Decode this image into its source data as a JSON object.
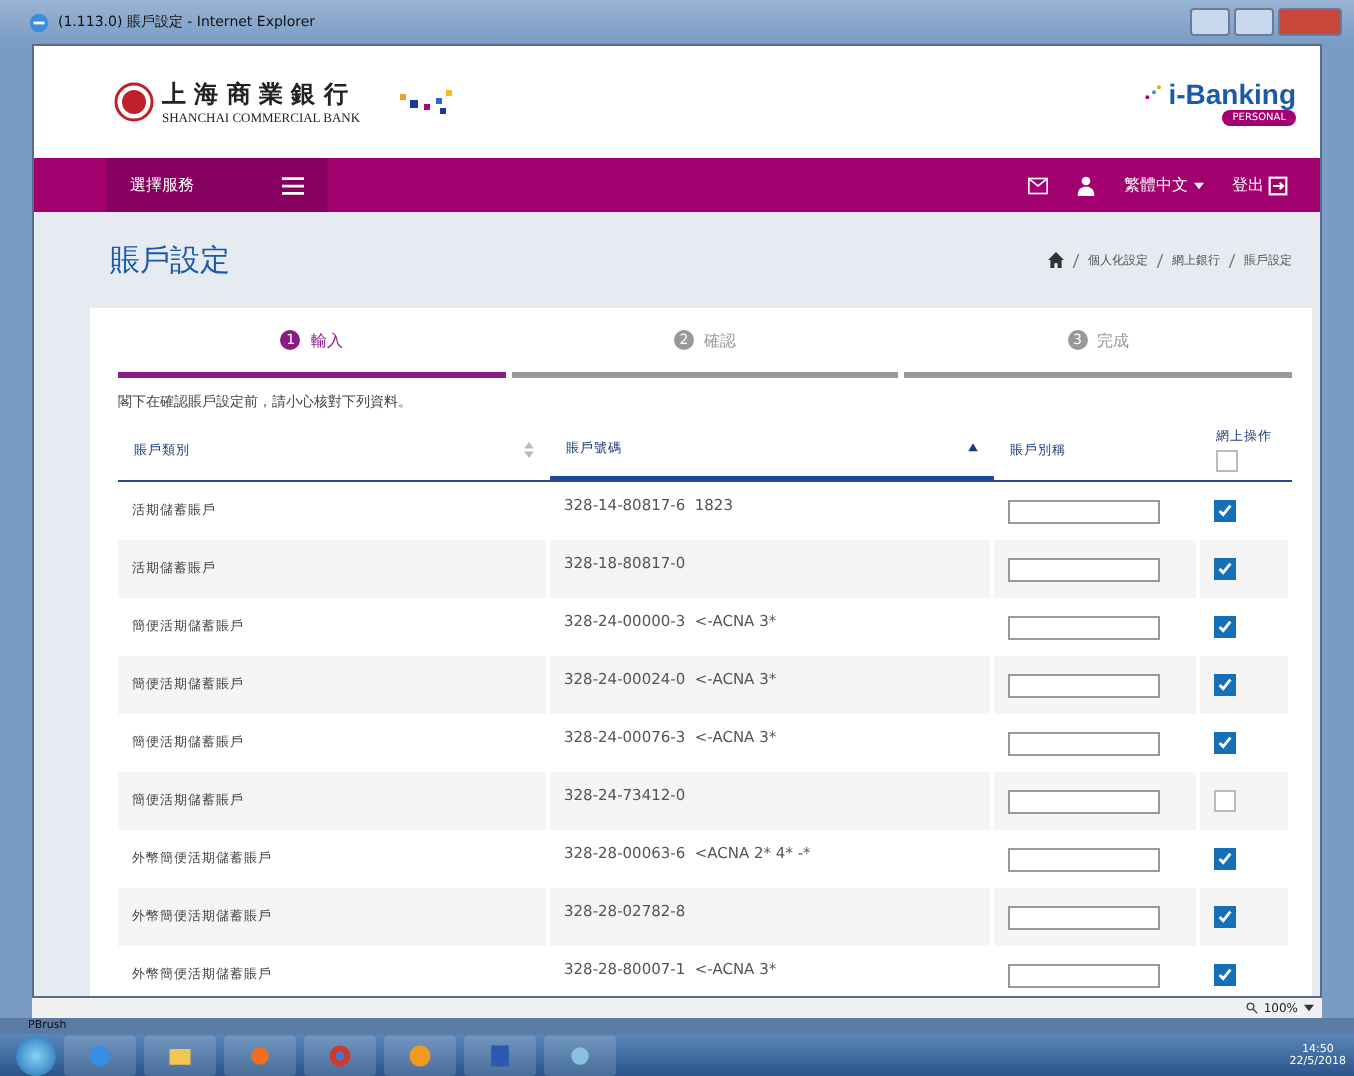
{
  "window": {
    "title": "(1.113.0) 賬戶設定 - Internet Explorer"
  },
  "header": {
    "bank_name": "上 海 商 業 銀 行",
    "bank_name_en": "SHANCHAI COMMERCIAL BANK",
    "brand": "i-Banking",
    "brand_badge": "PERSONAL"
  },
  "nav": {
    "menu_label": "選擇服務",
    "language": "繁體中文",
    "logout": "登出"
  },
  "page": {
    "title": "賬戶設定",
    "breadcrumb": [
      "個人化設定",
      "網上銀行",
      "賬戶設定"
    ]
  },
  "steps": [
    {
      "number": "1",
      "label": "輸入",
      "selected": true
    },
    {
      "number": "2",
      "label": "確認",
      "selected": false
    },
    {
      "number": "3",
      "label": "完成",
      "selected": false
    }
  ],
  "note": "閣下在確認賬戶設定前，請小心核對下列資料。",
  "table": {
    "columns": [
      "賬戶類別",
      "賬戶號碼",
      "賬戶別稱",
      "網上操作"
    ],
    "select_all_checked": false,
    "rows": [
      {
        "type": "活期儲蓄賬戶",
        "number": "328-14-80817-6",
        "remark": "1823",
        "checked": true
      },
      {
        "type": "活期儲蓄賬戶",
        "number": "328-18-80817-0",
        "checked": true
      },
      {
        "type": "簡便活期儲蓄賬戶",
        "number": "328-24-00000-3",
        "remark": "<-ACNA 3*",
        "checked": true
      },
      {
        "type": "簡便活期儲蓄賬戶",
        "number": "328-24-00024-0",
        "remark": "<-ACNA 3*",
        "checked": true
      },
      {
        "type": "簡便活期儲蓄賬戶",
        "number": "328-24-00076-3",
        "remark": "<-ACNA 3*",
        "checked": true
      },
      {
        "type": "簡便活期儲蓄賬戶",
        "number": "328-24-73412-0",
        "checked": false
      },
      {
        "type": "外幣簡便活期儲蓄賬戶",
        "number": "328-28-00063-6",
        "remark": "<ACNA 2* 4* -*",
        "checked": true
      },
      {
        "type": "外幣簡便活期儲蓄賬戶",
        "number": "328-28-02782-8",
        "checked": true
      },
      {
        "type": "外幣簡便活期儲蓄賬戶",
        "number": "328-28-80007-1",
        "remark": "<-ACNA 3*",
        "checked": true
      }
    ]
  },
  "status_bar": {
    "zoom": "100%",
    "app_status": "PBrush"
  },
  "taskbar": {
    "time": "14:50",
    "date": "22/5/2018"
  }
}
